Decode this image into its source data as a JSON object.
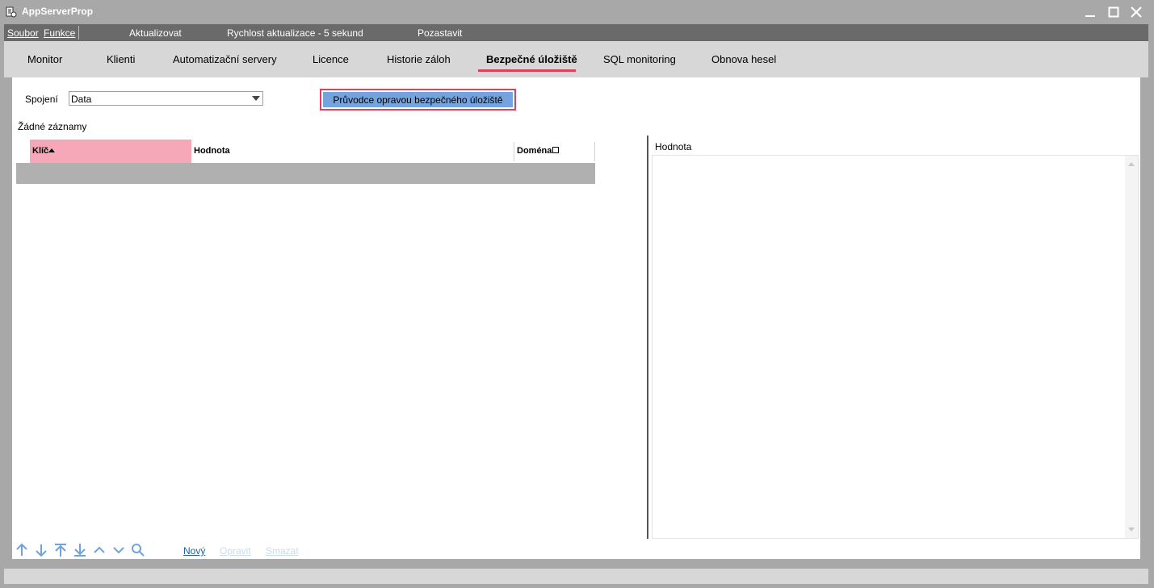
{
  "window": {
    "title": "AppServerProp",
    "icons": [
      "app-icon",
      "minimize-icon",
      "maximize-icon",
      "close-icon"
    ]
  },
  "menu": {
    "soubor": "Soubor",
    "funkce": "Funkce",
    "aktualizovat": "Aktualizovat",
    "rychlost": "Rychlost aktualizace - 5 sekund",
    "pozastavit": "Pozastavit"
  },
  "tabs": [
    {
      "label": "Monitor"
    },
    {
      "label": "Klienti"
    },
    {
      "label": "Automatizační servery"
    },
    {
      "label": "Licence"
    },
    {
      "label": "Historie záloh"
    },
    {
      "label": "Bezpečné úložiště",
      "active": true
    },
    {
      "label": "SQL monitoring"
    },
    {
      "label": "Obnova hesel"
    }
  ],
  "connection": {
    "label": "Spojení",
    "value": "Data"
  },
  "wizard_button": "Průvodce opravou bezpečného úložiště",
  "status_text": "Žádné záznamy",
  "grid": {
    "columns": [
      "Klíč",
      "Hodnota",
      "Doména"
    ],
    "sorted_column": "Klíč",
    "sort_direction": "ascending"
  },
  "value_panel": {
    "label": "Hodnota"
  },
  "toolbar": {
    "nav_icons": [
      "arrow-up-icon",
      "arrow-down-icon",
      "arrow-first-icon",
      "arrow-last-icon",
      "chevron-up-icon",
      "chevron-down-icon",
      "search-icon"
    ],
    "novy": "Nový",
    "opravit": "Opravit",
    "smazat": "Smazat"
  },
  "colors": {
    "accent": "#e0405a",
    "wizard_fill": "#74a3dd",
    "sorted_header": "#f7a8b8",
    "icon_blue": "#6fa3dc",
    "link": "#1f5fa8"
  }
}
